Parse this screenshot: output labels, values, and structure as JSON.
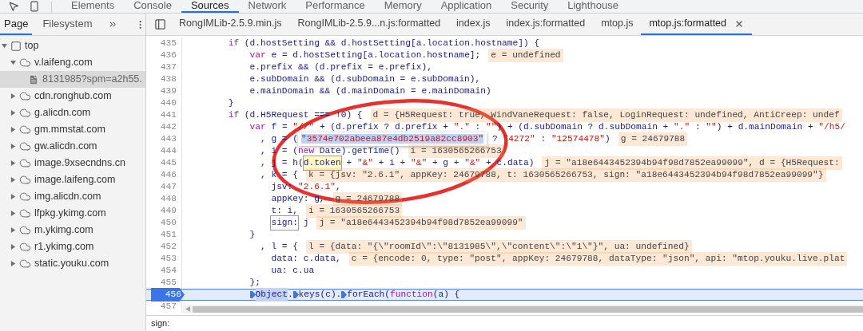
{
  "toolbar": {
    "tabs": [
      {
        "label": "Elements",
        "selected": false
      },
      {
        "label": "Console",
        "selected": false
      },
      {
        "label": "Sources",
        "selected": true
      },
      {
        "label": "Network",
        "selected": false
      },
      {
        "label": "Performance",
        "selected": false
      },
      {
        "label": "Memory",
        "selected": false
      },
      {
        "label": "Application",
        "selected": false
      },
      {
        "label": "Security",
        "selected": false
      },
      {
        "label": "Lighthouse",
        "selected": false
      }
    ]
  },
  "navigator": {
    "tabs": [
      {
        "label": "Page",
        "selected": true
      },
      {
        "label": "Filesystem",
        "selected": false
      }
    ],
    "tree": [
      {
        "label": "top",
        "kind": "frame",
        "expanded": true,
        "selected": false,
        "children": [
          {
            "label": "v.laifeng.com",
            "kind": "domain",
            "expanded": true,
            "selected": false,
            "children": [
              {
                "label": "8131985?spm=a2h55.",
                "kind": "file",
                "selected": true
              }
            ]
          },
          {
            "label": "cdn.ronghub.com",
            "kind": "domain",
            "expanded": false,
            "selected": false
          },
          {
            "label": "g.alicdn.com",
            "kind": "domain",
            "expanded": false,
            "selected": false
          },
          {
            "label": "gm.mmstat.com",
            "kind": "domain",
            "expanded": false,
            "selected": false
          },
          {
            "label": "gw.alicdn.com",
            "kind": "domain",
            "expanded": false,
            "selected": false
          },
          {
            "label": "image.9xsecndns.cn",
            "kind": "domain",
            "expanded": false,
            "selected": false
          },
          {
            "label": "image.laifeng.com",
            "kind": "domain",
            "expanded": false,
            "selected": false
          },
          {
            "label": "img.alicdn.com",
            "kind": "domain",
            "expanded": false,
            "selected": false
          },
          {
            "label": "lfpkg.ykimg.com",
            "kind": "domain",
            "expanded": false,
            "selected": false
          },
          {
            "label": "m.ykimg.com",
            "kind": "domain",
            "expanded": false,
            "selected": false
          },
          {
            "label": "r1.ykimg.com",
            "kind": "domain",
            "expanded": false,
            "selected": false
          },
          {
            "label": "static.youku.com",
            "kind": "domain",
            "expanded": false,
            "selected": false
          }
        ]
      }
    ]
  },
  "editor": {
    "tabs": [
      {
        "label": "RongIMLib-2.5.9.min.js",
        "selected": false,
        "closable": false
      },
      {
        "label": "RongIMLib-2.5.9...n.js:formatted",
        "selected": false,
        "closable": false
      },
      {
        "label": "index.js",
        "selected": false,
        "closable": false
      },
      {
        "label": "index.js:formatted",
        "selected": false,
        "closable": false
      },
      {
        "label": "mtop.js",
        "selected": false,
        "closable": false
      },
      {
        "label": "mtop.js:formatted",
        "selected": true,
        "closable": true
      }
    ],
    "lines": [
      {
        "number": "435",
        "current": false,
        "code": [
          {
            "kind": "kw",
            "text": "        if"
          },
          {
            "kind": "code",
            "text": " (d.hostSetting && d.hostSetting[a.location.hostname]) {"
          }
        ]
      },
      {
        "number": "436",
        "current": false,
        "code": [
          {
            "kind": "kw",
            "text": "            var"
          },
          {
            "kind": "code",
            "text": " e = d.hostSetting[a.location.hostname];"
          }
        ],
        "value": "e = undefined"
      },
      {
        "number": "437",
        "current": false,
        "code": [
          {
            "kind": "code",
            "text": "            e.prefix && (d.prefix = e.prefix),"
          }
        ]
      },
      {
        "number": "438",
        "current": false,
        "code": [
          {
            "kind": "code",
            "text": "            e.subDomain && (d.subDomain = e.subDomain),"
          }
        ]
      },
      {
        "number": "439",
        "current": false,
        "code": [
          {
            "kind": "code",
            "text": "            e.mainDomain && (d.mainDomain = e.mainDomain)"
          }
        ]
      },
      {
        "number": "440",
        "current": false,
        "code": [
          {
            "kind": "code",
            "text": "        }"
          }
        ]
      },
      {
        "number": "441",
        "current": false,
        "code": [
          {
            "kind": "kw",
            "text": "        if"
          },
          {
            "kind": "code",
            "text": " (d.H5Request === !0) {"
          }
        ],
        "value": "d = {H5Request: true, WindVaneRequest: false, LoginRequest: undefined, AntiCreep: undef"
      },
      {
        "number": "442",
        "current": false,
        "code": [
          {
            "kind": "kw",
            "text": "            var"
          },
          {
            "kind": "code",
            "text": " f = "
          },
          {
            "kind": "str",
            "text": "\"//\""
          },
          {
            "kind": "code",
            "text": " + (d.prefix ? d.prefix + "
          },
          {
            "kind": "str",
            "text": "\".\""
          },
          {
            "kind": "code",
            "text": " : "
          },
          {
            "kind": "str",
            "text": "\"\""
          },
          {
            "kind": "code",
            "text": ") + (d.subDomain ? d.subDomain + "
          },
          {
            "kind": "str",
            "text": "\".\""
          },
          {
            "kind": "code",
            "text": " : "
          },
          {
            "kind": "str",
            "text": "\"\""
          },
          {
            "kind": "code",
            "text": ") + d.mainDomain + "
          },
          {
            "kind": "str",
            "text": "\"/h5/"
          }
        ]
      },
      {
        "number": "443",
        "current": false,
        "code": [
          {
            "kind": "code",
            "text": "              , g = ("
          },
          {
            "kind": "popover",
            "text": "\"3574e702abeea87e4db2519a82cc8903\""
          },
          {
            "kind": "code",
            "text": " ? "
          },
          {
            "kind": "str",
            "text": "\"4272\""
          },
          {
            "kind": "code",
            "text": " : "
          },
          {
            "kind": "str",
            "text": "\"12574478\""
          },
          {
            "kind": "code",
            "text": ")"
          }
        ],
        "value": "g = 24679788"
      },
      {
        "number": "444",
        "current": false,
        "code": [
          {
            "kind": "code",
            "text": "              , i = ("
          },
          {
            "kind": "kw",
            "text": "new"
          },
          {
            "kind": "code",
            "text": " Date).getTime()"
          }
        ],
        "value": "i = 1630565266753"
      },
      {
        "number": "445",
        "current": false,
        "code": [
          {
            "kind": "code",
            "text": "              , j = h("
          },
          {
            "kind": "hover",
            "text": "d.token"
          },
          {
            "kind": "code",
            "text": " + "
          },
          {
            "kind": "str",
            "text": "\"&\""
          },
          {
            "kind": "code",
            "text": " + i + "
          },
          {
            "kind": "str",
            "text": "\"&\""
          },
          {
            "kind": "code",
            "text": " + g + "
          },
          {
            "kind": "str",
            "text": "\"&\""
          },
          {
            "kind": "code",
            "text": " + c.data)"
          }
        ],
        "value": "j = \"a18e6443452394b94f98d7852ea99099\", d = {H5Request:"
      },
      {
        "number": "446",
        "current": false,
        "code": [
          {
            "kind": "code",
            "text": "              , k = {"
          }
        ],
        "value": "k = {jsv: \"2.6.1\", appKey: 24679788, t: 1630565266753, sign: \"a18e6443452394b94f98d7852ea99099\"}"
      },
      {
        "number": "447",
        "current": false,
        "code": [
          {
            "kind": "code",
            "text": "                jsv: "
          },
          {
            "kind": "str",
            "text": "\"2.6.1\""
          },
          {
            "kind": "code",
            "text": ","
          }
        ]
      },
      {
        "number": "448",
        "current": false,
        "code": [
          {
            "kind": "code",
            "text": "                appKey: g,"
          }
        ],
        "value": "g = 24679788"
      },
      {
        "number": "449",
        "current": false,
        "code": [
          {
            "kind": "code",
            "text": "                t: i,"
          }
        ],
        "value": "i = 1630565266753"
      },
      {
        "number": "450",
        "current": false,
        "code": [
          {
            "kind": "boxed",
            "text": "                sign:"
          },
          {
            "kind": "code",
            "text": " j"
          }
        ],
        "value": "j = \"a18e6443452394b94f98d7852ea99099\""
      },
      {
        "number": "451",
        "current": false,
        "code": [
          {
            "kind": "code",
            "text": "            }"
          }
        ]
      },
      {
        "number": "452",
        "current": false,
        "code": [
          {
            "kind": "code",
            "text": "              , l = {"
          }
        ],
        "value": "l = {data: \"{\\\"roomId\\\":\\\"8131985\\\",\\\"content\\\":\\\"1\\\"}\", ua: undefined}"
      },
      {
        "number": "453",
        "current": false,
        "code": [
          {
            "kind": "code",
            "text": "                data: c.data,"
          }
        ],
        "value": "c = {encode: 0, type: \"post\", appKey: 24679788, dataType: \"json\", api: \"mtop.youku.live.plat"
      },
      {
        "number": "454",
        "current": false,
        "code": [
          {
            "kind": "code",
            "text": "                ua: c.ua"
          }
        ]
      },
      {
        "number": "455",
        "current": false,
        "code": [
          {
            "kind": "code",
            "text": "            };"
          }
        ]
      },
      {
        "number": "456",
        "current": true,
        "code": [
          {
            "kind": "active",
            "text": "            Object",
            "marker": true
          },
          {
            "kind": "code",
            "text": "."
          },
          {
            "kind": "code",
            "text": "keys(c).",
            "marker": true
          },
          {
            "kind": "code",
            "text": "forEach(",
            "marker": true
          },
          {
            "kind": "kw",
            "text": "function"
          },
          {
            "kind": "code",
            "text": "(a) {"
          }
        ]
      },
      {
        "number": "457",
        "current": false
      }
    ],
    "search": {
      "value": "sign:"
    }
  },
  "annotation": {
    "kind": "ellipse"
  }
}
